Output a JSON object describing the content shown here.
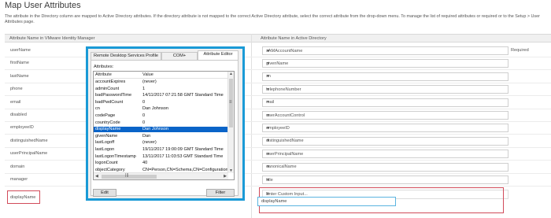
{
  "page": {
    "title": "Map User Attributes",
    "instructions": "The attribute in the Directory column are mapped to Active Directory attributes. If the directory attribute is not mapped to the correct Active Directory attribute, select the correct attribute from the drop-down menu. To manage the list of required attributes or required or to the Setup > User Attributes page."
  },
  "table": {
    "col_left": "Attribute Name in VMware Identity Manager",
    "col_right": "Attribute Name in Active Directory",
    "rows": [
      {
        "attr": "userName",
        "mapped": "sAMAccountName",
        "required": "Required"
      },
      {
        "attr": "firstName",
        "mapped": "givenName",
        "required": ""
      },
      {
        "attr": "lastName",
        "mapped": "sn",
        "required": ""
      },
      {
        "attr": "phone",
        "mapped": "telephoneNumber",
        "required": ""
      },
      {
        "attr": "email",
        "mapped": "mail",
        "required": ""
      },
      {
        "attr": "disabled",
        "mapped": "userAccountControl",
        "required": ""
      },
      {
        "attr": "employeeID",
        "mapped": "employeeID",
        "required": ""
      },
      {
        "attr": "distinguishedName",
        "mapped": "distinguishedName",
        "required": ""
      },
      {
        "attr": "userPrincipalName",
        "mapped": "userPrincipalName",
        "required": ""
      },
      {
        "attr": "domain",
        "mapped": "canonicalName",
        "required": ""
      },
      {
        "attr": "manager",
        "mapped": "title",
        "required": ""
      }
    ],
    "last_row": {
      "attr": "displayName",
      "dropdown": "Enter Custom Input...",
      "custom_value": "displayName"
    },
    "caret": "▼"
  },
  "dialog": {
    "tabs": [
      "Remote Desktop Services Profile",
      "COM+",
      "Attribute Editor"
    ],
    "active_tab": "Attribute Editor",
    "attributes_label": "Attributes:",
    "list_headers": {
      "name": "Attribute",
      "value": "Value"
    },
    "list_rows": [
      {
        "name": "accountExpires",
        "value": "(never)"
      },
      {
        "name": "adminCount",
        "value": "1"
      },
      {
        "name": "badPasswordTime",
        "value": "14/11/2017 07:21:58 GMT Standard Time"
      },
      {
        "name": "badPwdCount",
        "value": "0"
      },
      {
        "name": "cn",
        "value": "Dan Johnson"
      },
      {
        "name": "codePage",
        "value": "0"
      },
      {
        "name": "countryCode",
        "value": "0"
      },
      {
        "name": "displayName",
        "value": "Dan Johnson"
      },
      {
        "name": "givenName",
        "value": "Dan"
      },
      {
        "name": "lastLogoff",
        "value": "(never)"
      },
      {
        "name": "lastLogon",
        "value": "19/11/2017 19:00:09 GMT Standard Time"
      },
      {
        "name": "lastLogonTimestamp",
        "value": "13/11/2017 11:03:53 GMT Standard Time"
      },
      {
        "name": "logonCount",
        "value": "40"
      },
      {
        "name": "objectCategory",
        "value": "CN=Person,CN=Schema,CN=Configuration,DC"
      }
    ],
    "selected_row": "displayName",
    "edit_button": "Edit",
    "filter_button": "Filter"
  },
  "colors": {
    "dialog_highlight": "#1a9ad6",
    "error_outline": "#d14b5a",
    "selection": "#0a64c8",
    "input_focus": "#5ab4e0"
  }
}
